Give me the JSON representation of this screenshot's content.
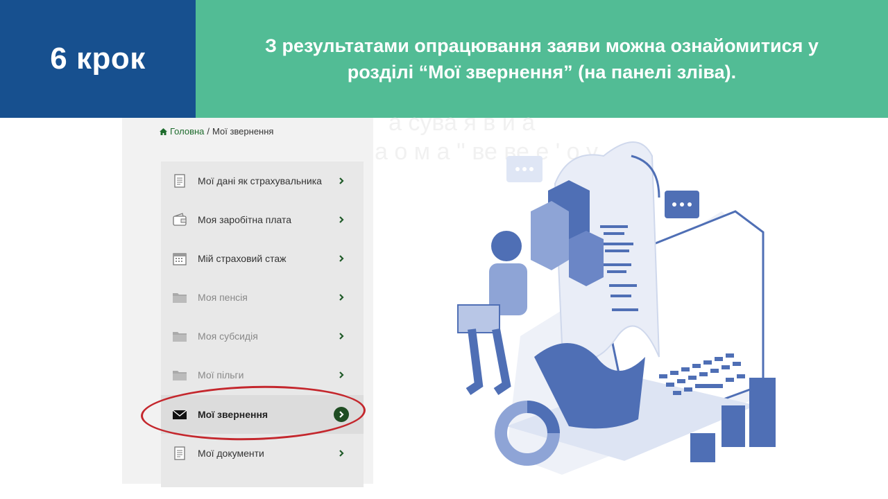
{
  "header": {
    "step_label": "6 крок",
    "title_line1": "З результатами опрацювання заяви можна ознайомитися у",
    "title_line2": "розділі “Мої звернення” (на панелі зліва)."
  },
  "ghost_text": {
    "line1": "а сува   я  в и  а",
    "line2": "а о м  а  '' ве ве е   ' о у"
  },
  "breadcrumb": {
    "home": "Головна",
    "separator": "/",
    "current": "Мої звернення"
  },
  "menu": {
    "items": [
      {
        "label": "Мої дані як страхувальника",
        "icon": "document-icon"
      },
      {
        "label": "Моя заробітна плата",
        "icon": "wallet-icon"
      },
      {
        "label": "Мій страховий стаж",
        "icon": "calendar-icon"
      },
      {
        "label": "Моя пенсія",
        "icon": "folder-icon"
      },
      {
        "label": "Моя субсидія",
        "icon": "folder-icon"
      },
      {
        "label": "Мої пільги",
        "icon": "folder-icon"
      },
      {
        "label": "Мої звернення",
        "icon": "envelope-icon",
        "active": true
      },
      {
        "label": "Мої документи",
        "icon": "document-icon"
      }
    ]
  },
  "colors": {
    "step_bg": "#17508f",
    "title_bg": "#52bc95",
    "highlight": "#c4272d",
    "accent_green": "#1f4d23",
    "illustration_blue": "#4f6fb5"
  }
}
